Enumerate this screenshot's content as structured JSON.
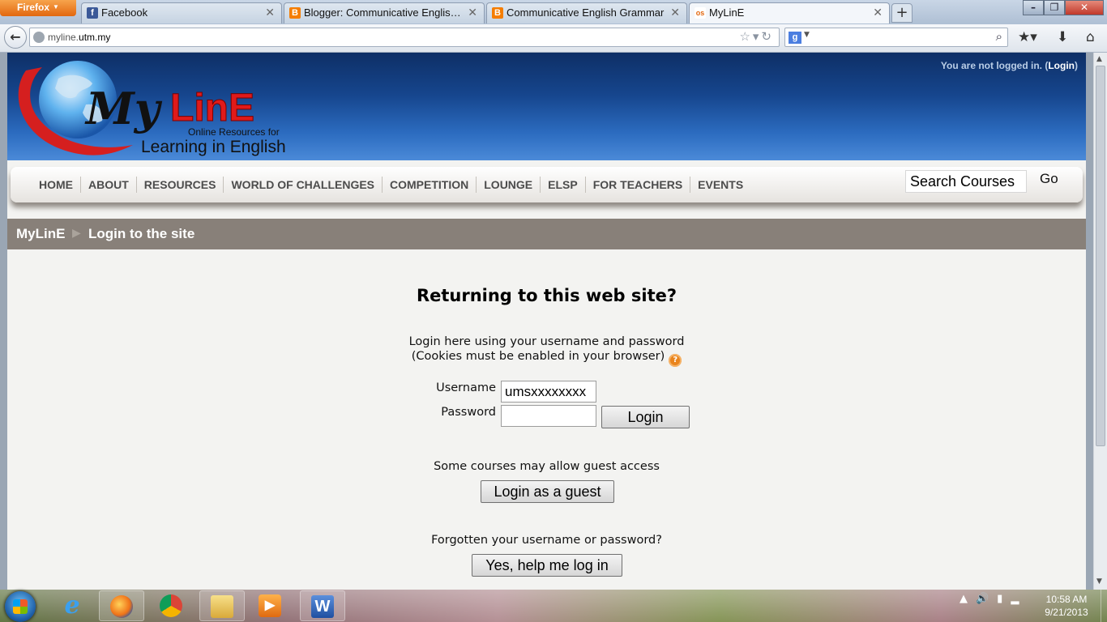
{
  "browser": {
    "menu_label": "Firefox",
    "tabs": [
      {
        "title": "Facebook",
        "icon": "facebook-icon",
        "color": "#3b5998",
        "glyph": "f"
      },
      {
        "title": "Blogger: Communicative English Gra...",
        "icon": "blogger-icon",
        "color": "#f57d00",
        "glyph": "B"
      },
      {
        "title": "Communicative English Grammar",
        "icon": "blogger-icon",
        "color": "#f57d00",
        "glyph": "B"
      },
      {
        "title": "MyLinE",
        "icon": "myline-icon",
        "color": "#ffffff",
        "glyph": "os"
      }
    ],
    "url_prefix": "myline.",
    "url_domain": "utm.my"
  },
  "page": {
    "login_status_text": "You are not logged in. (",
    "login_link": "Login",
    "login_status_end": ")",
    "logo": {
      "tag_line1": "Online Resources for",
      "tag_line2": "Learning in English",
      "brand_my": "My",
      "brand_line": "LinE"
    },
    "nav": [
      "HOME",
      "ABOUT",
      "RESOURCES",
      "WORLD OF CHALLENGES",
      "COMPETITION",
      "LOUNGE",
      "ELSP",
      "FOR TEACHERS",
      "EVENTS"
    ],
    "search_placeholder": "Search Courses",
    "go_label": "Go",
    "breadcrumb": {
      "home": "MyLinE",
      "separator": "▶",
      "current": "Login to the site"
    },
    "login": {
      "heading": "Returning to this web site?",
      "desc_line1": "Login here using your username and password",
      "desc_line2": "(Cookies must be enabled in your browser)",
      "username_label": "Username",
      "username_value": "umsxxxxxxxx",
      "password_label": "Password",
      "login_button": "Login",
      "guest_note": "Some courses may allow guest access",
      "guest_button": "Login as a guest",
      "forgot_note": "Forgotten your username or password?",
      "help_button": "Yes, help me log in"
    }
  },
  "taskbar": {
    "time": "10:58 AM",
    "date": "9/21/2013"
  }
}
